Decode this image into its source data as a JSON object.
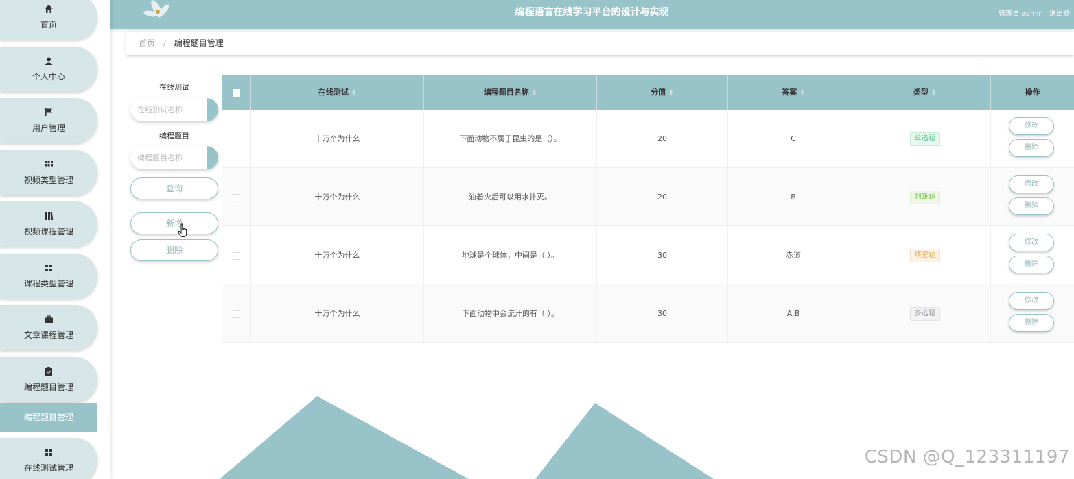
{
  "header": {
    "title": "编程语言在线学习平台的设计与实现",
    "user": "管理员 admin",
    "logout": "退出登"
  },
  "sidebar": {
    "items": [
      {
        "label": "首页",
        "icon": "home-icon"
      },
      {
        "label": "个人中心",
        "icon": "user-icon"
      },
      {
        "label": "用户管理",
        "icon": "flag-icon"
      },
      {
        "label": "视频类型管理",
        "icon": "grid-icon"
      },
      {
        "label": "视频课程管理",
        "icon": "book-icon"
      },
      {
        "label": "课程类型管理",
        "icon": "squares-icon"
      },
      {
        "label": "文章课程管理",
        "icon": "briefcase-icon"
      },
      {
        "label": "编程题目管理",
        "icon": "clipboard-icon"
      },
      {
        "label": "在线测试管理",
        "icon": "squares-icon"
      }
    ],
    "active_sub": "编程题目管理"
  },
  "breadcrumb": {
    "home": "首页",
    "separator": "/",
    "current": "编程题目管理"
  },
  "search": {
    "test_label": "在线测试",
    "test_placeholder": "在线测试名称",
    "question_label": "编程题目",
    "question_placeholder": "编程题目名称",
    "query_button": "查询",
    "add_button": "新增",
    "delete_button": "删除"
  },
  "table": {
    "columns": [
      "在线测试",
      "编程题目名称",
      "分值",
      "答案",
      "类型",
      "操作"
    ],
    "rows": [
      {
        "test": "十万个为什么",
        "name": "下面动物不属于昆虫的是（）。",
        "score": "20",
        "answer": "C",
        "type": "单选题",
        "type_style": "success"
      },
      {
        "test": "十万个为什么",
        "name": "油着火后可以用水扑灭。",
        "score": "20",
        "answer": "B",
        "type": "判断题",
        "type_style": "judge"
      },
      {
        "test": "十万个为什么",
        "name": "地球是个球体，中间是（ ）。",
        "score": "30",
        "answer": "赤道",
        "type": "填空题",
        "type_style": "warning"
      },
      {
        "test": "十万个为什么",
        "name": "下面动物中会流汗的有（ ）。",
        "score": "30",
        "answer": "A,B",
        "type": "多选题",
        "type_style": "info"
      }
    ],
    "edit_label": "修改",
    "delete_label": "删除"
  },
  "colors": {
    "accent": "#98c3c8",
    "nav_bg": "#d6e5e7"
  },
  "watermark": "CSDN @Q_123311197"
}
